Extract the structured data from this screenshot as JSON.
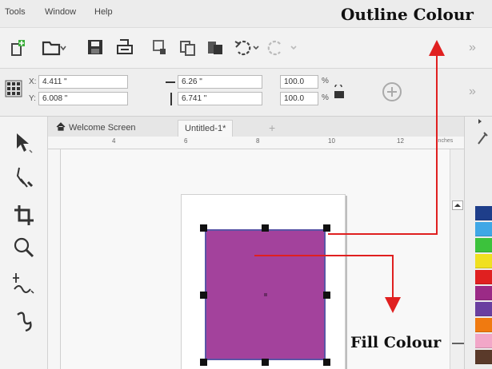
{
  "menu": {
    "tools": "Tools",
    "window": "Window",
    "help": "Help"
  },
  "callouts": {
    "outline": "Outline Colour",
    "fill": "Fill Colour"
  },
  "props": {
    "x_label": "X:",
    "x_value": "4.411 \"",
    "y_label": "Y:",
    "y_value": "6.008 \"",
    "w_value": "6.26 \"",
    "h_value": "6.741 \"",
    "scale_w": "100.0",
    "scale_h": "100.0",
    "percent": "%"
  },
  "tabs": {
    "welcome": "Welcome Screen",
    "untitled": "Untitled-1*",
    "add": "+"
  },
  "ruler": {
    "unit": "inches",
    "ticks": [
      "4",
      "6",
      "8",
      "10",
      "12"
    ]
  },
  "colors": {
    "fill": "#a3429c",
    "outline": "#5a55a6",
    "annotation": "#e02020"
  },
  "palette": [
    "#1e3e8a",
    "#3fa7e6",
    "#3cc23c",
    "#f0e020",
    "#e02020",
    "#9b2a86",
    "#6a3fa0",
    "#f07a10",
    "#f2a7c8",
    "#5a3a2a"
  ]
}
